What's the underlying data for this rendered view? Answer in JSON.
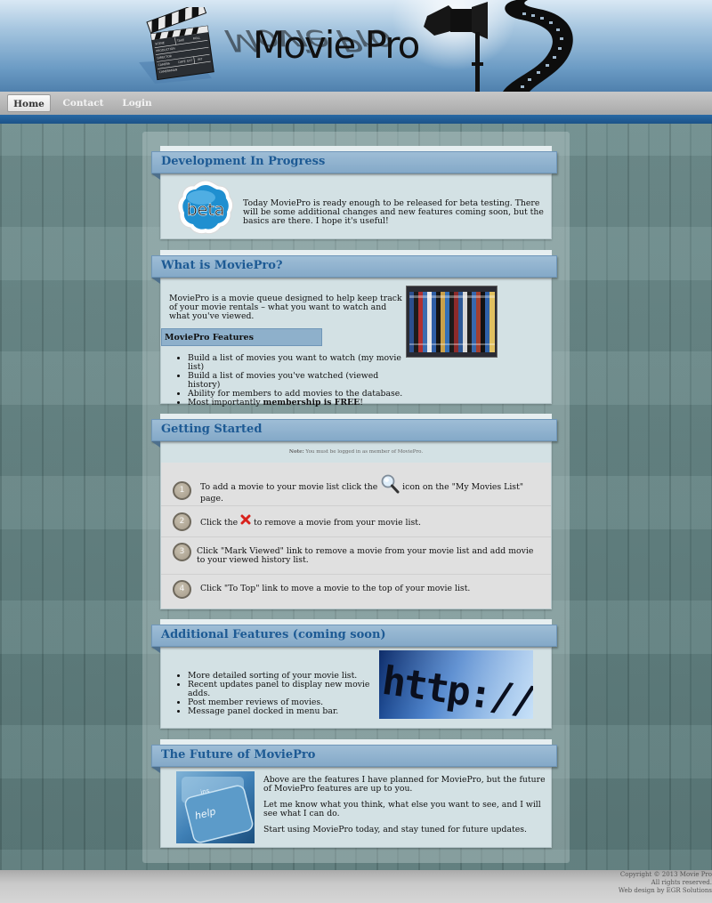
{
  "header": {
    "logo_text": "Movie Pro",
    "clapper_labels": [
      "SCENE",
      "TAKE",
      "ROLL",
      "PRODUCTION",
      "DIRECTOR",
      "CAMERA",
      "DATE",
      "EXT",
      "INT",
      "CAMERAMAN"
    ]
  },
  "nav": {
    "items": [
      {
        "label": "Home",
        "active": true
      },
      {
        "label": "Contact",
        "active": false
      },
      {
        "label": "Login",
        "active": false
      }
    ]
  },
  "sections": {
    "development": {
      "title": "Development In Progress",
      "badge_text": "beta",
      "text": "Today MoviePro is ready enough to be released for beta testing. There will be some additional changes and new features coming soon, but the basics are there. I hope it's useful!"
    },
    "what_is": {
      "title": "What is MoviePro?",
      "intro": "MoviePro is a movie queue designed to help keep track of your movie rentals – what you want to watch and what you've viewed.",
      "features_heading": "MoviePro Features",
      "features": [
        "Build a list of movies you want to watch (my movie list)",
        "Build a list of movies you've watched (viewed history)",
        "Ability for members to add movies to the database."
      ],
      "last_feature_prefix": "Most importantly ",
      "last_feature_bold": "membership is FREE",
      "last_feature_suffix": "!"
    },
    "getting_started": {
      "title": "Getting Started",
      "note_label": "Note:",
      "note_text": " You must be logged in as member of MoviePro.",
      "steps": [
        {
          "num": "1",
          "before": "To add a movie to your movie list click the ",
          "after": " icon on the \"My Movies List\" page.",
          "icon": "magnifier-icon"
        },
        {
          "num": "2",
          "before": "Click the ",
          "after": " to remove a movie from your movie list.",
          "icon": "remove-x-icon"
        },
        {
          "num": "3",
          "text": "Click \"Mark Viewed\" link to remove a movie from your movie list and add movie to your viewed history list."
        },
        {
          "num": "4",
          "text": "Click \"To Top\" link to move a movie to the top of your movie list."
        }
      ]
    },
    "additional": {
      "title": "Additional Features (coming soon)",
      "items": [
        "More detailed sorting of your movie list.",
        "Recent updates panel to display new movie adds.",
        "Post member reviews of movies.",
        "Message panel docked in menu bar."
      ],
      "image_text": "http://w"
    },
    "future": {
      "title": "The Future of MoviePro",
      "image_key_top": "ins",
      "image_key_main": "help",
      "paragraphs": [
        "Above are the features I have planned for MoviePro, but the future of MoviePro features are up to you.",
        "Let me know what you think, what else you want to see, and I will see what I can do.",
        "Start using MoviePro today, and stay tuned for future updates."
      ]
    }
  },
  "footer": {
    "copyright": "Copyright © 2013 Movie Pro",
    "rights": "All rights reserved.",
    "credit": "Web design by EGR Solutions"
  },
  "colors": {
    "accent_blue": "#1d5a94",
    "ribbon": "#84a9c8",
    "panel": "#d3e1e4",
    "nav_bar": "#2a6aa4",
    "remove_icon": "#d8211c"
  }
}
